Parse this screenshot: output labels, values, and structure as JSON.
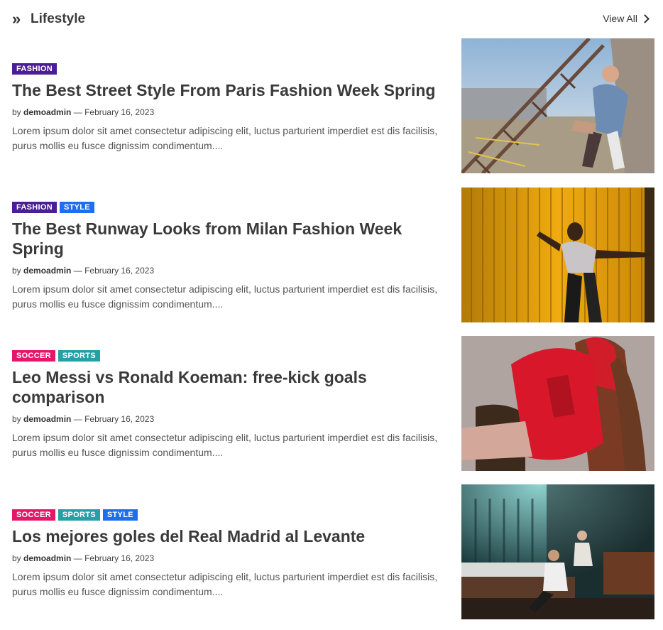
{
  "section": {
    "title": "Lifestyle",
    "view_all": "View All"
  },
  "tag_colors": {
    "FASHION": "#4b1d96",
    "STYLE": "#1e6ff0",
    "SOCCER": "#e5176a",
    "SPORTS": "#26a0a6"
  },
  "posts": [
    {
      "tags": [
        "FASHION"
      ],
      "title": "The Best Street Style From Paris Fashion Week Spring",
      "by": "by",
      "author": "demoadmin",
      "sep": "—",
      "date": "February 16, 2023",
      "excerpt": "Lorem ipsum dolor sit amet consectetur adipiscing elit, luctus parturient imperdiet est dis facilisis, purus mollis eu fusce dignissim condimentum....",
      "image": "woman-on-stairs-photo"
    },
    {
      "tags": [
        "FASHION",
        "STYLE"
      ],
      "title": "The Best Runway Looks from Milan Fashion Week Spring",
      "by": "by",
      "author": "demoadmin",
      "sep": "—",
      "date": "February 16, 2023",
      "excerpt": "Lorem ipsum dolor sit amet consectetur adipiscing elit, luctus parturient imperdiet est dis facilisis, purus mollis eu fusce dignissim condimentum....",
      "image": "woman-yellow-wall-photo"
    },
    {
      "tags": [
        "SOCCER",
        "SPORTS"
      ],
      "title": "Leo Messi vs Ronald Koeman: free-kick goals comparison",
      "by": "by",
      "author": "demoadmin",
      "sep": "—",
      "date": "February 16, 2023",
      "excerpt": "Lorem ipsum dolor sit amet consectetur adipiscing elit, luctus parturient imperdiet est dis facilisis, purus mollis eu fusce dignissim condimentum....",
      "image": "woman-red-outfit-photo"
    },
    {
      "tags": [
        "SOCCER",
        "SPORTS",
        "STYLE"
      ],
      "title": "Los mejores goles del Real Madrid al Levante",
      "by": "by",
      "author": "demoadmin",
      "sep": "—",
      "date": "February 16, 2023",
      "excerpt": "Lorem ipsum dolor sit amet consectetur adipiscing elit, luctus parturient imperdiet est dis facilisis, purus mollis eu fusce dignissim condimentum....",
      "image": "couple-in-room-photo"
    }
  ]
}
